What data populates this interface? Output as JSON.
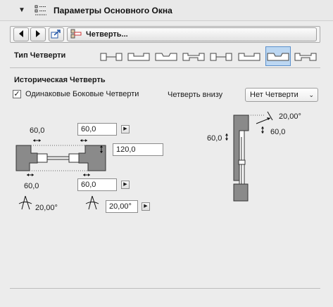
{
  "header": {
    "title": "Параметры Основного Окна",
    "collapse_icon": "triangle-down-icon",
    "panel_icon": "settings-list-icon"
  },
  "toolbar": {
    "prev_icon": "arrow-left-icon",
    "next_icon": "arrow-right-icon",
    "favorites_icon": "favorites-icon",
    "current_label": "Четверть...",
    "current_icon": "reveal-section-icon"
  },
  "reveal_type": {
    "label": "Тип Четверти",
    "options": [
      "type-1",
      "type-2",
      "type-3",
      "type-4",
      "type-5",
      "type-6",
      "type-7",
      "type-8"
    ],
    "selected_index": 6
  },
  "historic": {
    "section_title": "Историческая Четверть",
    "same_sides_label": "Одинаковые Боковые Четверти",
    "same_sides_checked": true,
    "bottom_label": "Четверть внизу",
    "bottom_value": "Нет Четверти"
  },
  "left_diagram": {
    "top_left_value": "60,0",
    "top_right_field": "60,0",
    "depth_field": "120,0",
    "bottom_left_value": "60,0",
    "bottom_right_field": "60,0",
    "angle_left": "20,00°",
    "angle_right_field": "20,00°"
  },
  "right_diagram": {
    "angle_value": "20,00°",
    "right_value": "60,0",
    "left_value": "60,0"
  },
  "colors": {
    "selected_bg": "#bcd7f2",
    "selected_border": "#5b90cc",
    "wall_fill": "#8a8a8a"
  }
}
